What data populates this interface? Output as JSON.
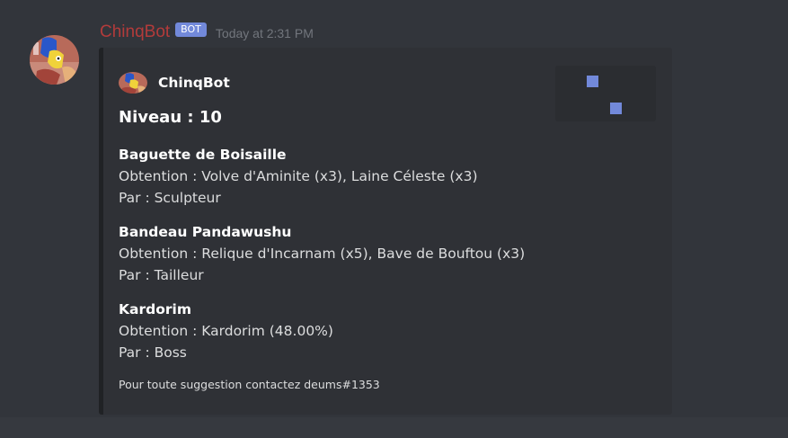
{
  "message": {
    "username": "ChinqBot",
    "bot_tag": "BOT",
    "timestamp": "Today at 2:31 PM",
    "username_color": "#b33b3b",
    "avatar_icon": "cartoon-avatar-icon"
  },
  "embed": {
    "author_name": "ChinqBot",
    "author_icon": "cartoon-avatar-icon",
    "title": "Niveau : 10",
    "thumbnail_icon": "two-blue-squares-icon",
    "fields": [
      {
        "name": "Baguette de Boisaille",
        "obtention": "Obtention : Volve d'Aminite (x3), Laine Céleste (x3)",
        "par": "Par : Sculpteur"
      },
      {
        "name": "Bandeau Pandawushu",
        "obtention": "Obtention : Relique d'Incarnam (x5), Bave de Bouftou (x3)",
        "par": "Par : Tailleur"
      },
      {
        "name": "Kardorim",
        "obtention": "Obtention : Kardorim (48.00%)",
        "par": "Par : Boss"
      }
    ],
    "footer": "Pour toute suggestion contactez deums#1353"
  },
  "colors": {
    "background": "#36393f",
    "embed_background": "#2f3136",
    "bot_tag": "#7289da",
    "timestamp": "#72767d"
  }
}
